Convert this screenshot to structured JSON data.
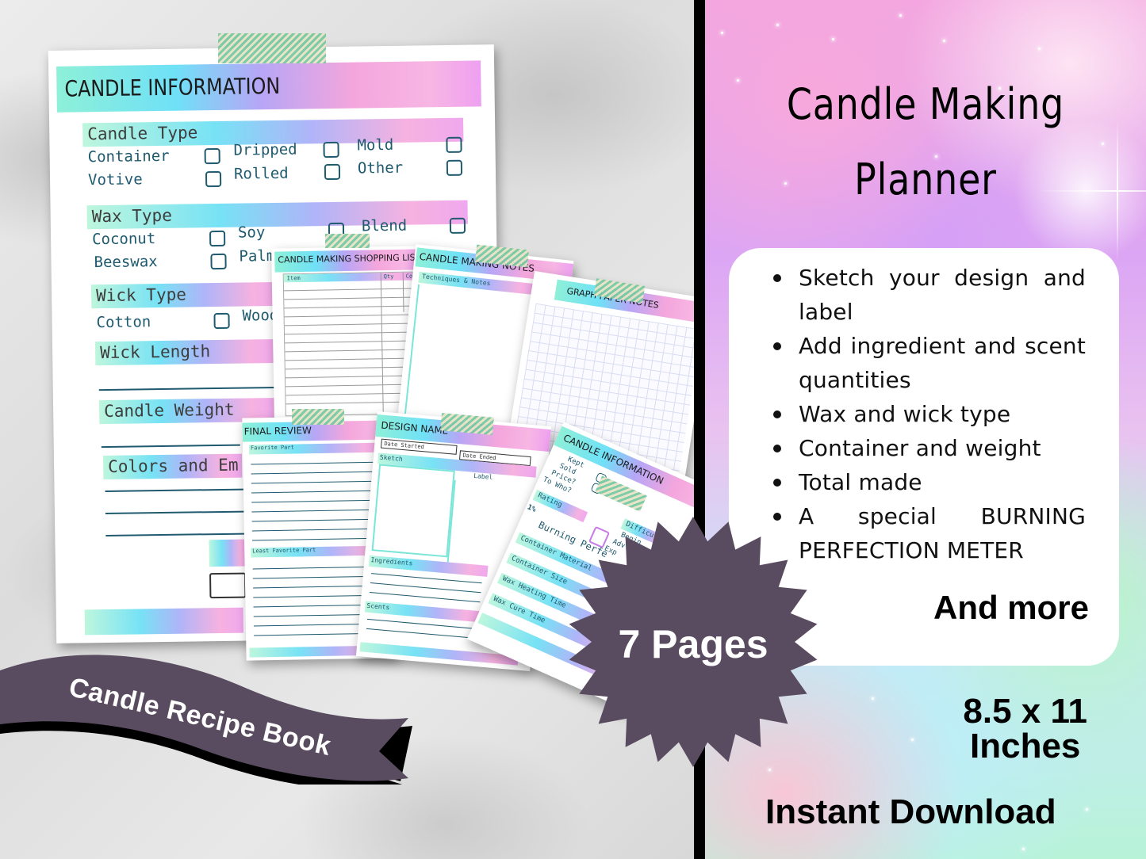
{
  "colors": {
    "badge": "#5a4c60",
    "ribbon": "#5a4c60",
    "divider": "#000000",
    "form_text": "#1f5a6e"
  },
  "preview": {
    "main_page": {
      "title": "CANDLE INFORMATION",
      "sections": {
        "candle_type": {
          "label": "Candle Type",
          "options": [
            "Container",
            "Dripped",
            "Mold",
            "Votive",
            "Rolled",
            "Other"
          ]
        },
        "wax_type": {
          "label": "Wax Type",
          "options": [
            "Coconut",
            "Soy",
            "Blend",
            "Beeswax",
            "Palm"
          ]
        },
        "wick_type": {
          "label": "Wick Type",
          "options": [
            "Cotton",
            "Wood"
          ]
        },
        "wick_length": {
          "label": "Wick Length"
        },
        "candle_weight": {
          "label": "Candle Weight"
        },
        "colors": {
          "label": "Colors and Em"
        }
      }
    },
    "shopping_list": {
      "title": "CANDLE MAKING SHOPPING LIST",
      "columns": [
        "Item",
        "Qty",
        "Co"
      ]
    },
    "notes": {
      "title": "CANDLE MAKING NOTES",
      "subtitle": "Techniques & Notes"
    },
    "graph": {
      "title": "GRAPH PAPER NOTES"
    },
    "final_review": {
      "title": "FINAL REVIEW",
      "favorite": "Favorite Part",
      "least_favorite": "Least Favorite Part"
    },
    "design": {
      "title": "DESIGN NAME",
      "date_started": "Date Started",
      "date_ended": "Date Ended",
      "sketch": "Sketch",
      "label": "Label",
      "ingredients": "Ingredients",
      "scents": "Scents"
    },
    "candle_info_small": {
      "title": "CANDLE INFORMATION",
      "kept": "Kept",
      "sold": "Sold",
      "price": "Price?",
      "to_who": "To Who?",
      "rating": "Rating",
      "difficulty": "Difficult",
      "levels": [
        "Begin",
        "Adv",
        "Exp"
      ],
      "percent": "1%",
      "burning": "Burning Perfe",
      "fields": [
        "Container Material",
        "Container Size",
        "Wax Heating Time",
        "Wax Cure Time"
      ]
    }
  },
  "badge": {
    "text": "7 Pages"
  },
  "ribbon": {
    "text": "Candle Recipe Book"
  },
  "right": {
    "title_line1": "Candle Making",
    "title_line2": "Planner",
    "features": [
      "Sketch your design and label",
      "Add ingredient and scent quantities",
      "Wax and wick type",
      "Container and weight",
      "Total made",
      "A special BURNING PERFECTION METER"
    ],
    "and_more": "And more",
    "size_line1": "8.5 x 11",
    "size_line2": "Inches",
    "download": "Instant Download"
  }
}
